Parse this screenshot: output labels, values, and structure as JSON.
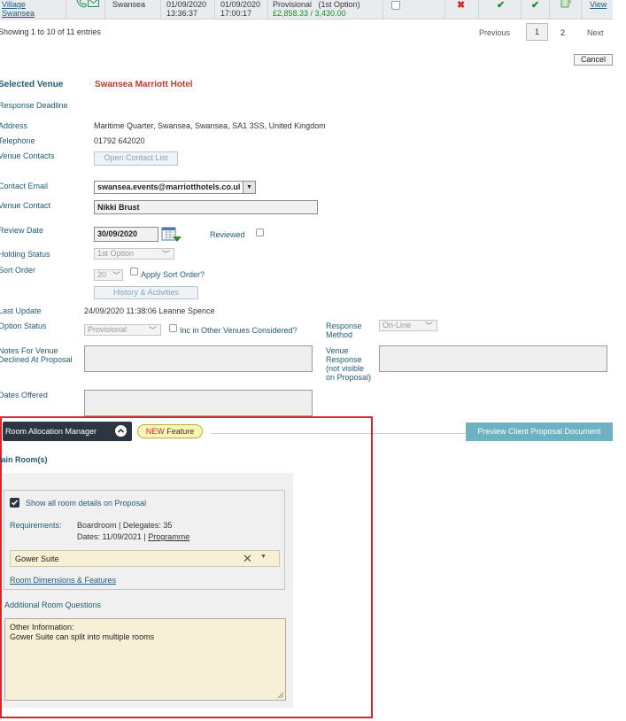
{
  "top_row": {
    "venue_line1": "Village",
    "venue_line2": "Swansea",
    "location": "Swansea",
    "date_from": "01/09/2020",
    "time_from": "13:36:37",
    "date_to": "01/09/2020",
    "time_to": "17:00:17",
    "status": "Provisional",
    "option": "(1st Option)",
    "amount": "£2,858.33 / 3,430.00",
    "view": "View"
  },
  "pagination": {
    "info": "Showing 1 to 10 of 11 entries",
    "previous": "Previous",
    "page1": "1",
    "page2": "2",
    "next": "Next"
  },
  "cancel_label": "Cancel",
  "venue": {
    "selected_label": "Selected Venue",
    "selected_value": "Swansea Marriott Hotel",
    "response_deadline_label": "Response Deadline",
    "address_label": "Address",
    "address_value": "Maritime Quarter, Swansea, Swansea, SA1 3SS, United Kingdom",
    "telephone_label": "Telephone",
    "telephone_value": "01792 642020",
    "contacts_label": "Venue Contacts",
    "open_contact_list": "Open Contact List",
    "contact_email_label": "Contact Email",
    "contact_email_value": "swansea.events@marriotthotels.co.ul",
    "venue_contact_label": "Venue Contact",
    "venue_contact_value": "Nikki Brust",
    "review_date_label": "Review Date",
    "review_date_value": "30/09/2020",
    "reviewed_label": "Reviewed",
    "holding_status_label": "Holding Status",
    "holding_status_value": "1st Option",
    "sort_order_label": "Sort Order",
    "sort_order_value": "20",
    "apply_sort_label": "Apply Sort Order?",
    "history_button": "History & Activities",
    "last_update_label": "Last Update",
    "last_update_value": "24/09/2020 11:38:06 Leanne Spence",
    "option_status_label": "Option Status",
    "option_status_value": "Provisional",
    "inc_other_label": "Inc in Other Venues Considered?",
    "response_method_label_1": "Response",
    "response_method_label_2": "Method",
    "response_method_value": "On-Line",
    "notes_label_1": "Notes For Venue",
    "notes_label_2": "Declined At Proposal",
    "venue_response_label_1": "Venue",
    "venue_response_label_2": "Response",
    "venue_response_label_3": "(not visible",
    "venue_response_label_4": "on Proposal)",
    "dates_offered_label": "Dates Offered"
  },
  "ram": {
    "title": "Room Allocation Manager",
    "badge_new": "NEW",
    "badge_feature": " Feature",
    "preview_button": "Preview Client Proposal Document",
    "main_rooms": "Main Room(s)",
    "show_all_label": "Show all room details on Proposal",
    "requirements_label": "Requirements:",
    "requirements_value": "Boardroom | Delegates: 35",
    "dates_prefix": "Dates: 11/09/2021 | ",
    "programme_link": "Programme",
    "room_select_value": "Gower Suite",
    "dimensions_link": "Room Dimensions & Features",
    "additional_questions": "Additional Room Questions",
    "other_info_line1": "Other Information:",
    "other_info_line2": "Gower Suite can split into multiple rooms"
  },
  "colors": {
    "label_blue": "#1f5b7a",
    "venue_red": "#c0392b",
    "green": "#1e8a2e",
    "highlight_red": "#d9262b",
    "preview_teal": "#6cb2c2",
    "ram_dark": "#2b3642",
    "badge_yellow": "#fdf5b8"
  }
}
